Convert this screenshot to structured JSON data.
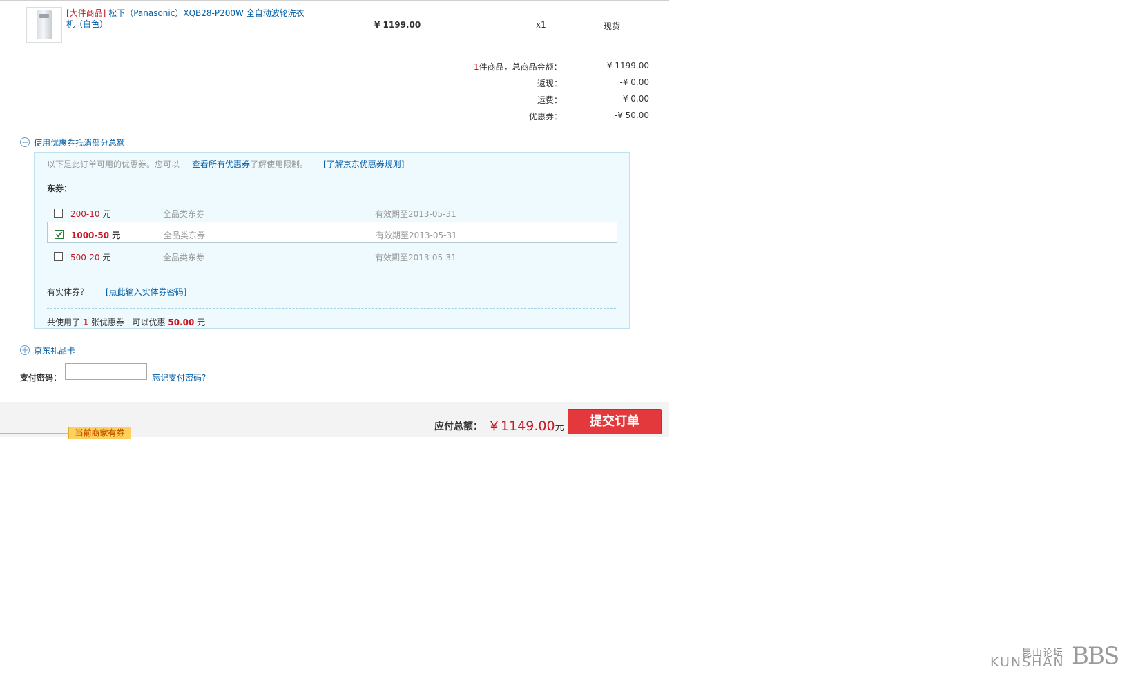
{
  "product": {
    "tag": "[大件商品]",
    "name_line1": "松下（Panasonic）XQB28-P200W 全自动波轮洗衣",
    "name_line2": "机（白色）",
    "price": "¥ 1199.00",
    "quantity": "x1",
    "stock": "现货"
  },
  "summary": {
    "count": "1",
    "total_label": "件商品，总商品金额：",
    "total_value": "¥ 1199.00",
    "cashback_label": "返现：",
    "cashback_value": "-¥ 0.00",
    "shipping_label": "运费：",
    "shipping_value": "¥ 0.00",
    "coupon_label": "优惠券：",
    "coupon_value": "-¥ 50.00"
  },
  "coupon_section": {
    "toggle_icon": "minus-circle-icon",
    "title": "使用优惠券抵消部分总额",
    "intro": "以下是此订单可用的优惠券。您可以",
    "view_all_link": "查看所有优惠券",
    "intro_suffix": "了解使用限制。",
    "rules_link": "[了解京东优惠券规则]",
    "group_label": "东券：",
    "unit": "元",
    "coupons": [
      {
        "amount": "200-10",
        "type": "全品类东券",
        "expiry": "有效期至2013-05-31",
        "checked": false
      },
      {
        "amount": "1000-50",
        "type": "全品类东券",
        "expiry": "有效期至2013-05-31",
        "checked": true
      },
      {
        "amount": "500-20",
        "type": "全品类东券",
        "expiry": "有效期至2013-05-31",
        "checked": false
      }
    ],
    "physical_label": "有实体券？",
    "physical_link": "[点此输入实体券密码]",
    "used_prefix": "共使用了",
    "used_count": "1",
    "used_mid": "张优惠券",
    "discount_prefix": "可以优惠",
    "discount_value": "50.00",
    "discount_suffix": "元"
  },
  "gift_card": {
    "toggle_icon": "plus-circle-icon",
    "title": "京东礼品卡"
  },
  "payment": {
    "password_label": "支付密码：",
    "password_value": "",
    "forgot_link": "忘记支付密码?"
  },
  "footer": {
    "total_label": "应付总额：",
    "total_amount": "￥1149.00",
    "total_unit": "元",
    "submit_label": "提交订单",
    "merchant_tag": "当前商家有券"
  },
  "watermark": {
    "chinese": "昆山论坛",
    "latin": "KUNSHAN",
    "bbs": "BBS"
  }
}
